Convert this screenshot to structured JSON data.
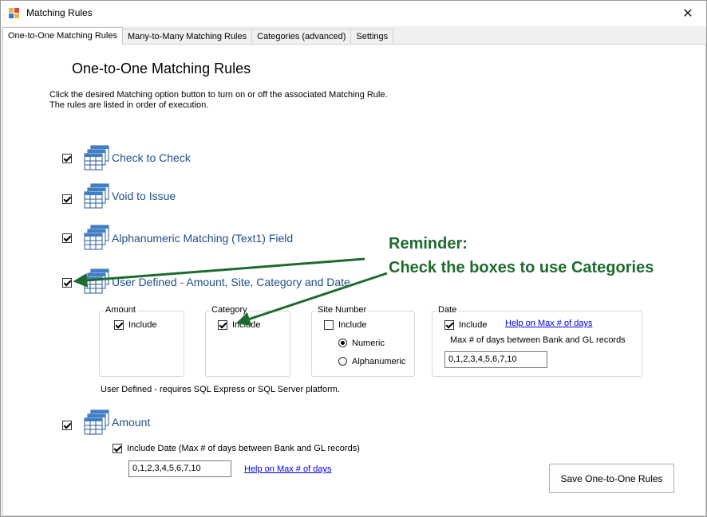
{
  "window": {
    "title": "Matching Rules",
    "close_glyph": "✕",
    "app_icon": "app-icon"
  },
  "tabs": [
    {
      "label": "One-to-One Matching Rules",
      "active": true
    },
    {
      "label": "Many-to-Many Matching Rules",
      "active": false
    },
    {
      "label": "Categories (advanced)",
      "active": false
    },
    {
      "label": "Settings",
      "active": false
    }
  ],
  "page": {
    "heading": "One-to-One Matching Rules",
    "instructions_line1": "Click the desired Matching option button to turn on or off the associated Matching Rule.",
    "instructions_line2": "The rules are listed in order of execution."
  },
  "rules": [
    {
      "label": "Check to Check",
      "checked": true,
      "icon": "table-icon"
    },
    {
      "label": "Void to Issue",
      "checked": true,
      "icon": "table-icon"
    },
    {
      "label": "Alphanumeric Matching (Text1) Field",
      "checked": true,
      "icon": "table-icon"
    },
    {
      "label": "User Defined - Amount, Site, Category and Date",
      "checked": true,
      "icon": "table-icon"
    },
    {
      "label": "Amount",
      "checked": true,
      "icon": "table-icon"
    }
  ],
  "user_defined": {
    "amount": {
      "title": "Amount",
      "include_label": "Include",
      "include_checked": true
    },
    "category": {
      "title": "Category",
      "include_label": "Include",
      "include_checked": true
    },
    "site": {
      "title": "Site Number",
      "include_label": "Include",
      "include_checked": false,
      "numeric_label": "Numeric",
      "alpha_label": "Alphanumeric",
      "selected": "Numeric"
    },
    "date": {
      "title": "Date",
      "include_label": "Include",
      "include_checked": true,
      "help_link": "Help on Max # of days",
      "max_days_label": "Max # of days between Bank and GL records",
      "max_days_value": "0,1,2,3,4,5,6,7,10"
    },
    "note": "User Defined - requires SQL Express or SQL Server platform."
  },
  "amount_rule": {
    "include_date_label": "Include Date (Max # of days between Bank and GL records)",
    "include_date_checked": true,
    "max_days_value": "0,1,2,3,4,5,6,7,10",
    "help_link": "Help on Max # of days"
  },
  "save_button": "Save One-to-One Rules",
  "annotation": {
    "line1": "Reminder:",
    "line2": "Check the boxes to use Categories",
    "color": "#1e6b2e"
  }
}
